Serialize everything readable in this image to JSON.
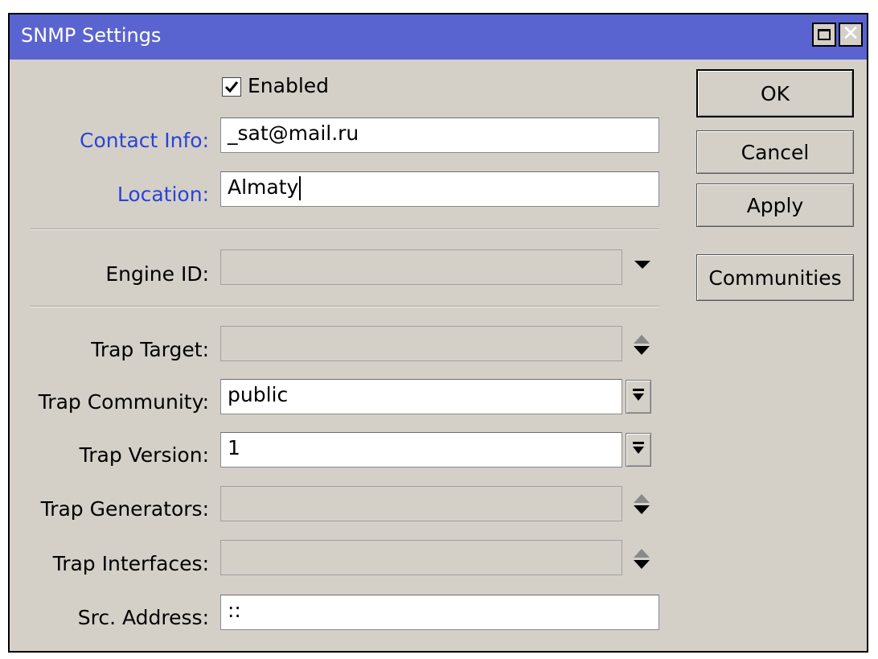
{
  "window": {
    "title": "SNMP Settings",
    "maximize_icon": "maximize-icon",
    "close_icon": "close-icon"
  },
  "form": {
    "enabled": {
      "label": "Enabled",
      "checked": true
    },
    "contact_info": {
      "label": "Contact Info:",
      "value": "_sat@mail.ru"
    },
    "location": {
      "label": "Location:",
      "value": "Almaty"
    },
    "engine_id": {
      "label": "Engine ID:",
      "value": ""
    },
    "trap_target": {
      "label": "Trap Target:",
      "value": ""
    },
    "trap_community": {
      "label": "Trap Community:",
      "value": "public"
    },
    "trap_version": {
      "label": "Trap Version:",
      "value": "1"
    },
    "trap_generators": {
      "label": "Trap Generators:",
      "value": ""
    },
    "trap_interfaces": {
      "label": "Trap Interfaces:",
      "value": ""
    },
    "src_address": {
      "label": "Src. Address:",
      "value": "::"
    }
  },
  "buttons": {
    "ok": "OK",
    "cancel": "Cancel",
    "apply": "Apply",
    "communities": "Communities"
  },
  "colors": {
    "titlebar": "#5a64d0",
    "dialog_bg": "#d4d0c8",
    "label_highlight": "#2a44d6"
  }
}
